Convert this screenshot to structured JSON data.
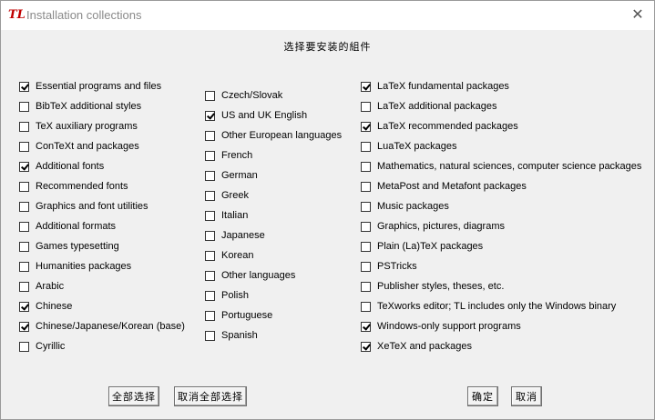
{
  "window": {
    "title": "Installation collections",
    "app_icon_glyph": "TL",
    "close_glyph": "✕"
  },
  "heading": "选择要安装的組件",
  "columns": [
    [
      {
        "label": "Essential programs and files",
        "checked": true
      },
      {
        "label": "BibTeX additional styles",
        "checked": false
      },
      {
        "label": "TeX auxiliary programs",
        "checked": false
      },
      {
        "label": "ConTeXt and packages",
        "checked": false
      },
      {
        "label": "Additional fonts",
        "checked": true
      },
      {
        "label": "Recommended fonts",
        "checked": false
      },
      {
        "label": "Graphics and font utilities",
        "checked": false
      },
      {
        "label": "Additional formats",
        "checked": false
      },
      {
        "label": "Games typesetting",
        "checked": false
      },
      {
        "label": "Humanities packages",
        "checked": false
      },
      {
        "label": "Arabic",
        "checked": false
      },
      {
        "label": "Chinese",
        "checked": true
      },
      {
        "label": "Chinese/Japanese/Korean (base)",
        "checked": true
      },
      {
        "label": "Cyrillic",
        "checked": false
      }
    ],
    [
      {
        "label": "Czech/Slovak",
        "checked": false
      },
      {
        "label": "US and UK English",
        "checked": true
      },
      {
        "label": "Other European languages",
        "checked": false
      },
      {
        "label": "French",
        "checked": false
      },
      {
        "label": "German",
        "checked": false
      },
      {
        "label": "Greek",
        "checked": false
      },
      {
        "label": "Italian",
        "checked": false
      },
      {
        "label": "Japanese",
        "checked": false
      },
      {
        "label": "Korean",
        "checked": false
      },
      {
        "label": "Other languages",
        "checked": false
      },
      {
        "label": "Polish",
        "checked": false
      },
      {
        "label": "Portuguese",
        "checked": false
      },
      {
        "label": "Spanish",
        "checked": false
      }
    ],
    [
      {
        "label": "LaTeX fundamental packages",
        "checked": true
      },
      {
        "label": "LaTeX additional packages",
        "checked": false
      },
      {
        "label": "LaTeX recommended packages",
        "checked": true
      },
      {
        "label": "LuaTeX packages",
        "checked": false
      },
      {
        "label": "Mathematics, natural sciences, computer science packages",
        "checked": false
      },
      {
        "label": "MetaPost and Metafont packages",
        "checked": false
      },
      {
        "label": "Music packages",
        "checked": false
      },
      {
        "label": "Graphics, pictures, diagrams",
        "checked": false
      },
      {
        "label": "Plain (La)TeX packages",
        "checked": false
      },
      {
        "label": "PSTricks",
        "checked": false
      },
      {
        "label": "Publisher styles, theses, etc.",
        "checked": false
      },
      {
        "label": "TeXworks editor; TL includes only the Windows binary",
        "checked": false
      },
      {
        "label": "Windows-only support programs",
        "checked": true
      },
      {
        "label": "XeTeX and packages",
        "checked": true
      }
    ]
  ],
  "buttons": {
    "select_all": "全部选择",
    "deselect_all": "取消全部选择",
    "ok": "确定",
    "cancel": "取消"
  }
}
